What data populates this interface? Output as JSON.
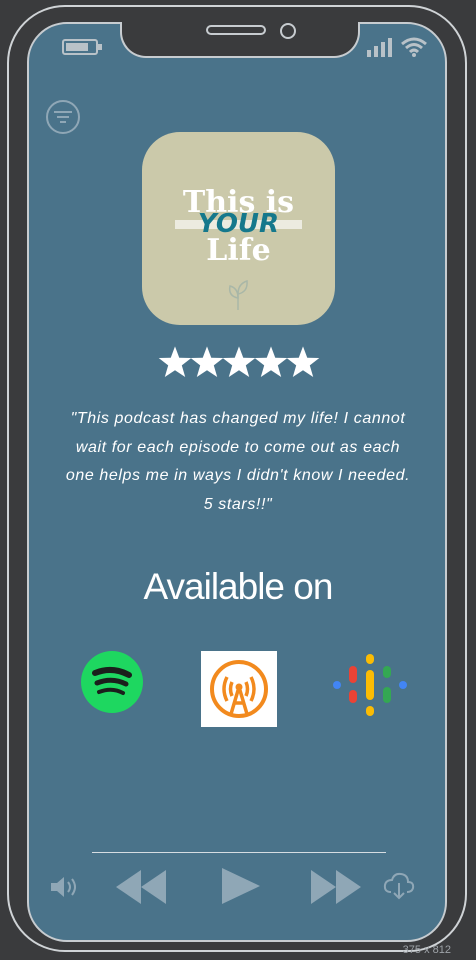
{
  "album": {
    "line1": "This is",
    "line2": "YOUR",
    "line3": "Life"
  },
  "rating": {
    "stars": 5,
    "max": 5
  },
  "review": "\"This podcast has changed my life! I cannot wait for each episode to come out as each one helps me in ways I didn't know I needed. 5 stars!!\"",
  "available_label": "Available on",
  "platforms": [
    {
      "name": "Spotify",
      "icon": "spotify-icon",
      "color": "#1ed760"
    },
    {
      "name": "Overcast",
      "icon": "overcast-icon",
      "color": "#f28a1e"
    },
    {
      "name": "Google Podcasts",
      "icon": "google-podcasts-icon",
      "color": "#4285f4"
    }
  ],
  "viewport_label": "375 x 812",
  "colors": {
    "screen_bg": "#4a738a",
    "frame": "#3a3b3d",
    "album_bg": "#cbc9aa",
    "accent": "#15788c"
  }
}
